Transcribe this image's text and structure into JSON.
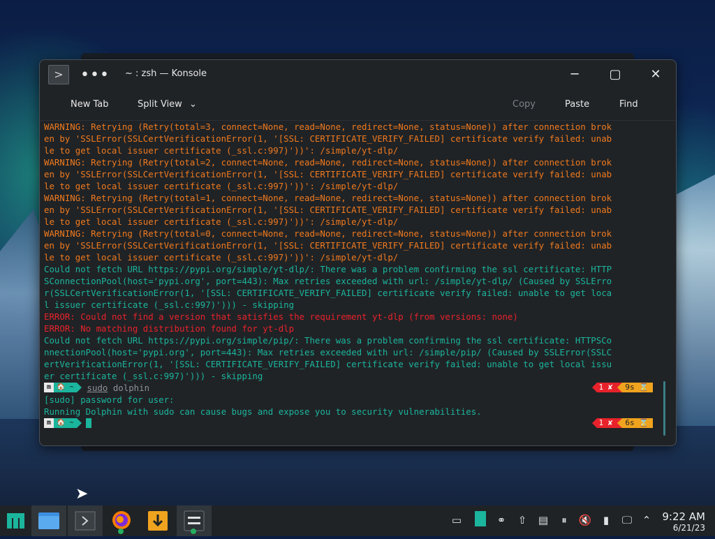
{
  "window": {
    "title": "~ : zsh — Konsole",
    "icon": "konsole-icon",
    "dots": "•••",
    "minimize": "─",
    "maximize": "▢",
    "close": "✕"
  },
  "toolbar": {
    "new_tab": "New Tab",
    "split_view": "Split View",
    "split_chevron": "⌄",
    "copy": "Copy",
    "paste": "Paste",
    "find": "Find"
  },
  "terminal": {
    "lines": [
      {
        "text": "WARNING: Retrying (Retry(total=3, connect=None, read=None, redirect=None, status=None)) after connection brok",
        "color": "warn"
      },
      {
        "text": "en by 'SSLError(SSLCertVerificationError(1, '[SSL: CERTIFICATE_VERIFY_FAILED] certificate verify failed: unab",
        "color": "warn"
      },
      {
        "text": "le to get local issuer certificate (_ssl.c:997)'))': /simple/yt-dlp/",
        "color": "warn"
      },
      {
        "text": "WARNING: Retrying (Retry(total=2, connect=None, read=None, redirect=None, status=None)) after connection brok",
        "color": "warn"
      },
      {
        "text": "en by 'SSLError(SSLCertVerificationError(1, '[SSL: CERTIFICATE_VERIFY_FAILED] certificate verify failed: unab",
        "color": "warn"
      },
      {
        "text": "le to get local issuer certificate (_ssl.c:997)'))': /simple/yt-dlp/",
        "color": "warn"
      },
      {
        "text": "WARNING: Retrying (Retry(total=1, connect=None, read=None, redirect=None, status=None)) after connection brok",
        "color": "warn"
      },
      {
        "text": "en by 'SSLError(SSLCertVerificationError(1, '[SSL: CERTIFICATE_VERIFY_FAILED] certificate verify failed: unab",
        "color": "warn"
      },
      {
        "text": "le to get local issuer certificate (_ssl.c:997)'))': /simple/yt-dlp/",
        "color": "warn"
      },
      {
        "text": "WARNING: Retrying (Retry(total=0, connect=None, read=None, redirect=None, status=None)) after connection brok",
        "color": "warn"
      },
      {
        "text": "en by 'SSLError(SSLCertVerificationError(1, '[SSL: CERTIFICATE_VERIFY_FAILED] certificate verify failed: unab",
        "color": "warn"
      },
      {
        "text": "le to get local issuer certificate (_ssl.c:997)'))': /simple/yt-dlp/",
        "color": "warn"
      },
      {
        "text": "Could not fetch URL https://pypi.org/simple/yt-dlp/: There was a problem confirming the ssl certificate: HTTP",
        "color": "cyan"
      },
      {
        "text": "SConnectionPool(host='pypi.org', port=443): Max retries exceeded with url: /simple/yt-dlp/ (Caused by SSLErro",
        "color": "cyan"
      },
      {
        "text": "r(SSLCertVerificationError(1, '[SSL: CERTIFICATE_VERIFY_FAILED] certificate verify failed: unable to get loca",
        "color": "cyan"
      },
      {
        "text": "l issuer certificate (_ssl.c:997)'))) - skipping",
        "color": "cyan"
      },
      {
        "text": "ERROR: Could not find a version that satisfies the requirement yt-dlp (from versions: none)",
        "color": "red"
      },
      {
        "text": "ERROR: No matching distribution found for yt-dlp",
        "color": "red"
      },
      {
        "text": "Could not fetch URL https://pypi.org/simple/pip/: There was a problem confirming the ssl certificate: HTTPSCo",
        "color": "cyan"
      },
      {
        "text": "nnectionPool(host='pypi.org', port=443): Max retries exceeded with url: /simple/pip/ (Caused by SSLError(SSLC",
        "color": "cyan"
      },
      {
        "text": "ertVerificationError(1, '[SSL: CERTIFICATE_VERIFY_FAILED] certificate verify failed: unable to get local issu",
        "color": "cyan"
      },
      {
        "text": "er certificate (_ssl.c:997)'))) - skipping",
        "color": "cyan"
      }
    ],
    "prompt1": {
      "logo": "m",
      "dir": "🏠 ~",
      "command_sudo": "sudo",
      "command_rest": " dolphin",
      "status_code": "1 ✘",
      "duration": "9s ⌛"
    },
    "after_lines": [
      {
        "text": "[sudo] password for user:",
        "color": "cyan"
      },
      {
        "text": "Running Dolphin with sudo can cause bugs and expose you to security vulnerabilities.",
        "color": "cyan"
      }
    ],
    "prompt2": {
      "logo": "m",
      "dir": "🏠 ~",
      "status_code": "1 ✘",
      "duration": "6s ⌛"
    }
  },
  "taskbar": {
    "items": [
      {
        "name": "manjaro-menu-icon"
      },
      {
        "name": "dolphin-file-manager-icon"
      },
      {
        "name": "konsole-task-icon"
      },
      {
        "name": "firefox-icon"
      },
      {
        "name": "downloader-icon"
      },
      {
        "name": "settings-task-icon"
      }
    ],
    "tray": [
      "window-icon",
      "teal-widget-icon",
      "kde-connect-icon",
      "update-icon",
      "clipboard-icon",
      "media-pause-icon",
      "volume-muted-icon",
      "usb-icon",
      "network-icon",
      "expand-tray-icon"
    ],
    "time": "9:22 AM",
    "date": "6/21/23"
  },
  "colors": {
    "warn": "#f07a1e",
    "cyan": "#1bb59d",
    "red": "#e8222b",
    "orange": "#f0a31e"
  }
}
